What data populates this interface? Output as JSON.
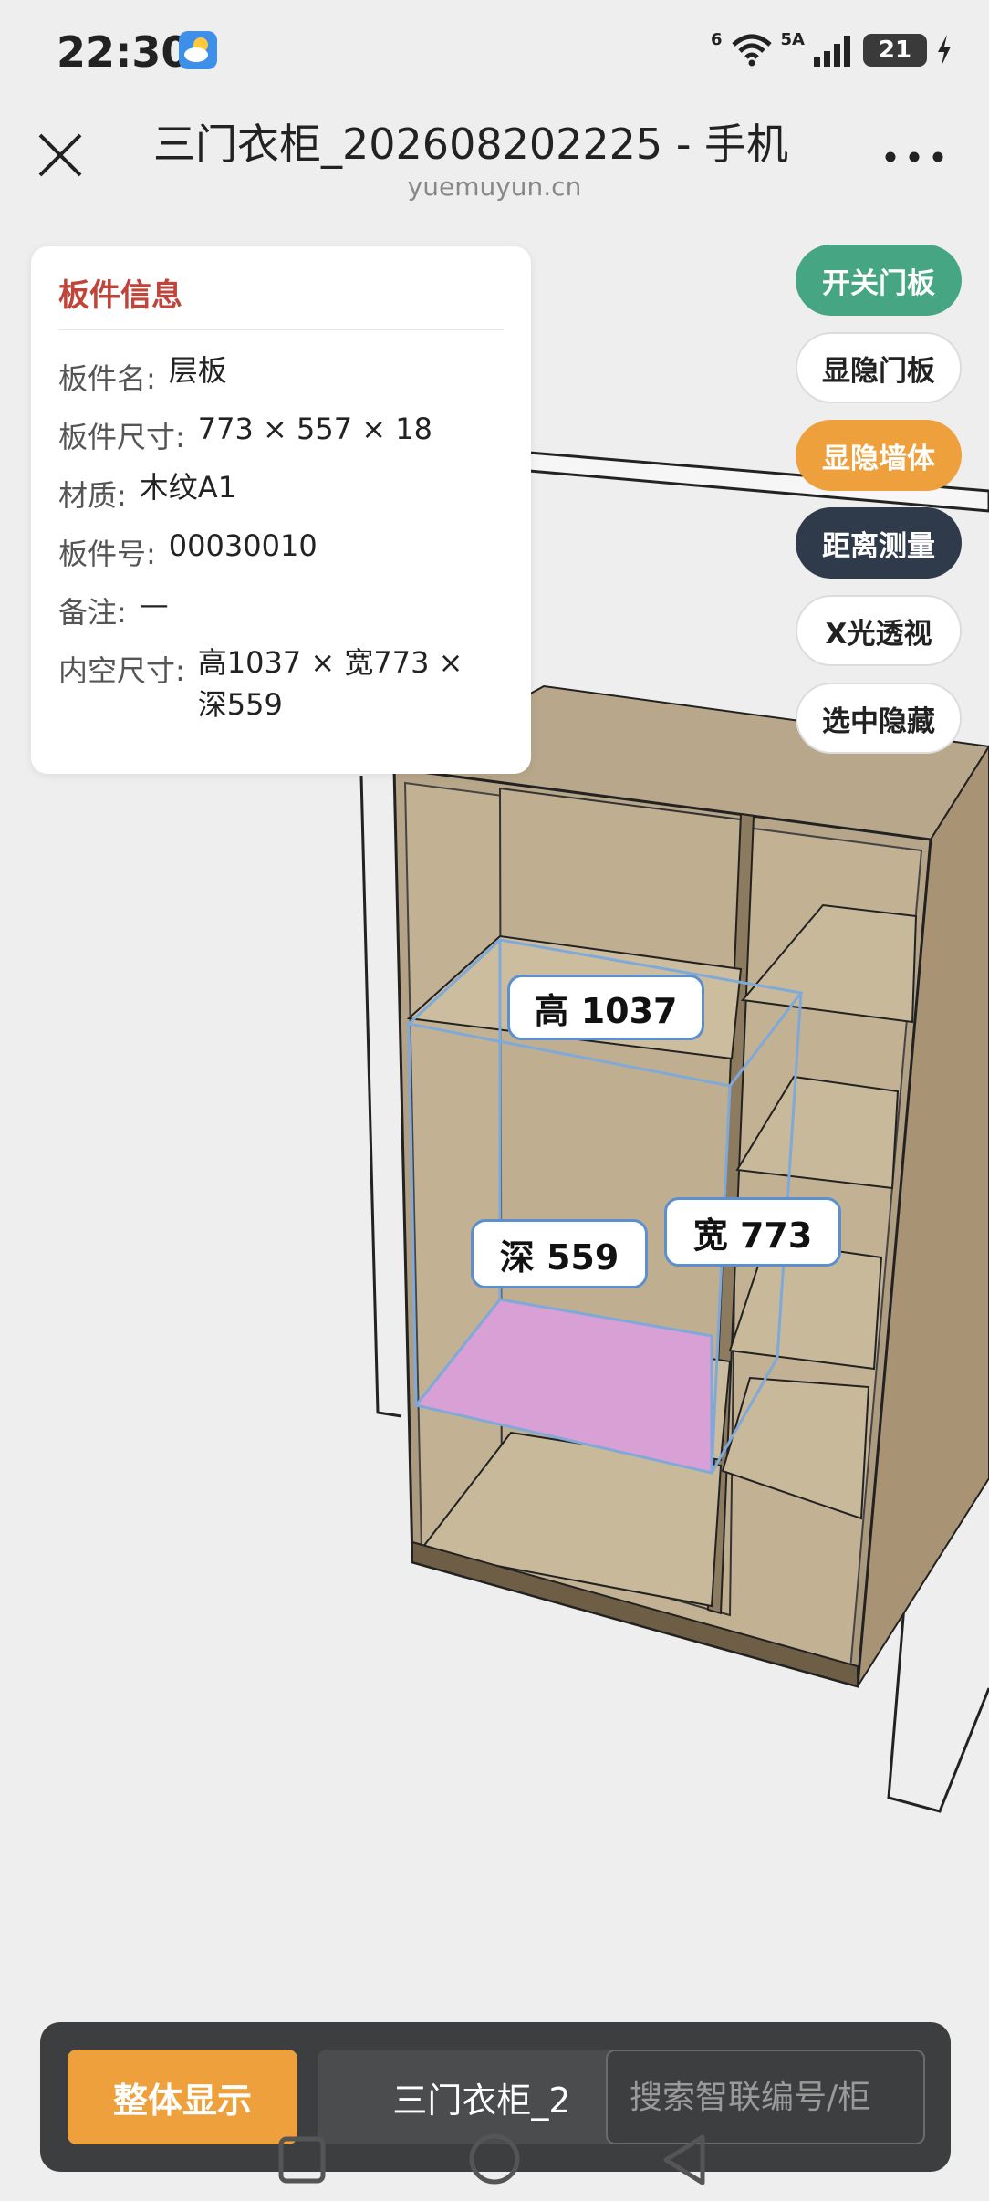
{
  "status": {
    "time": "22:30",
    "network": "5A",
    "wifi_label": "6",
    "battery": "21"
  },
  "header": {
    "title": "三门衣柜_202608202225 - 手机",
    "domain": "yuemuyun.cn"
  },
  "info": {
    "title": "板件信息",
    "rows": [
      {
        "label": "板件名:",
        "value": "层板"
      },
      {
        "label": "板件尺寸:",
        "value": "773 × 557 × 18"
      },
      {
        "label": "材质:",
        "value": "木纹A1"
      },
      {
        "label": "板件号:",
        "value": "00030010"
      },
      {
        "label": "备注:",
        "value": "—"
      },
      {
        "label": "内空尺寸:",
        "value": "高1037 × 宽773 × 深559"
      }
    ]
  },
  "buttons": {
    "toggle_door": "开关门板",
    "show_hide_door": "显隐门板",
    "show_hide_wall": "显隐墙体",
    "measure": "距离测量",
    "xray": "X光透视",
    "hide_selected": "选中隐藏"
  },
  "dimensions": {
    "height": "高 1037",
    "width": "宽 773",
    "depth": "深 559"
  },
  "bottom": {
    "overall": "整体显示",
    "model": "三门衣柜_2",
    "search_placeholder": "搜索智联编号/柜"
  },
  "colors": {
    "accent_orange": "#eea03c",
    "green": "#46a583",
    "dark": "#2f3a4a",
    "title_red": "#c0443a",
    "highlight_pink": "#d9a0d6"
  }
}
